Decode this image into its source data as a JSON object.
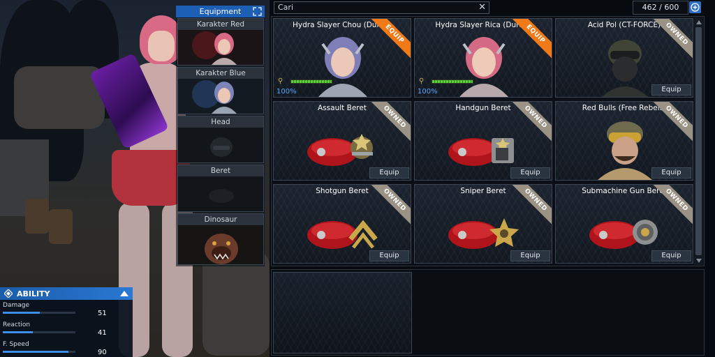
{
  "equipment_panel": {
    "title": "Equipment",
    "slots": [
      {
        "label": "Karakter Red"
      },
      {
        "label": "Karakter Blue"
      },
      {
        "label": "Head"
      },
      {
        "label": "Beret"
      },
      {
        "label": "Dinosaur"
      }
    ]
  },
  "ability": {
    "title": "ABILITY",
    "stats": [
      {
        "name": "Damage",
        "value": "51",
        "fill": 0.51
      },
      {
        "name": "Reaction",
        "value": "41",
        "fill": 0.41
      },
      {
        "name": "F. Speed",
        "value": "90",
        "fill": 0.9
      }
    ]
  },
  "search": {
    "value": "Cari",
    "clear_icon": "close-icon"
  },
  "inventory": {
    "count": "462 / 600",
    "add_icon": "plus-circle-icon"
  },
  "items": [
    {
      "title": "Hydra Slayer Chou (Durab)",
      "badge": "EQUIP",
      "durability": "100%",
      "durability_fraction": 1.0,
      "action": "",
      "art": "blue-hair-character"
    },
    {
      "title": "Hydra Slayer Rica (Durab)",
      "badge": "EQUIP",
      "durability": "100%",
      "durability_fraction": 1.0,
      "action": "",
      "art": "red-hair-character"
    },
    {
      "title": "Acid Pol (CT-FORCE)",
      "badge": "OWNED",
      "durability": "",
      "action": "Equip",
      "art": "masked-soldier"
    },
    {
      "title": "Assault Beret",
      "badge": "OWNED",
      "durability": "",
      "action": "Equip",
      "art": "beret-assault"
    },
    {
      "title": "Handgun Beret",
      "badge": "OWNED",
      "durability": "",
      "action": "Equip",
      "art": "beret-handgun"
    },
    {
      "title": "Red Bulls (Free Rebels)",
      "badge": "OWNED",
      "durability": "",
      "action": "Equip",
      "art": "goggles-soldier"
    },
    {
      "title": "Shotgun Beret",
      "badge": "OWNED",
      "durability": "",
      "action": "Equip",
      "art": "beret-shotgun"
    },
    {
      "title": "Sniper Beret",
      "badge": "OWNED",
      "durability": "",
      "action": "Equip",
      "art": "beret-sniper"
    },
    {
      "title": "Submachine Gun Beret",
      "badge": "OWNED",
      "durability": "",
      "action": "Equip",
      "art": "beret-smg"
    }
  ],
  "colors": {
    "accent": "#1d5fb4",
    "equip_badge": "#f07a17",
    "owned_badge": "#9a9284",
    "durability": "#5fcf3a",
    "beret_red": "#b0141b"
  }
}
